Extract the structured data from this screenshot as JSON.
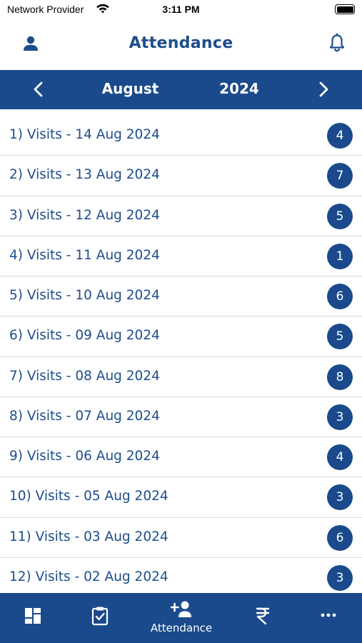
{
  "status_bar": {
    "carrier": "Network Provider",
    "time": "3:11 PM"
  },
  "header": {
    "title": "Attendance",
    "left_icon": "profile-icon",
    "right_icon": "bell-icon"
  },
  "month_selector": {
    "month": "August",
    "year": "2024",
    "prev_icon": "chevron-left-icon",
    "next_icon": "chevron-right-icon"
  },
  "visits": [
    {
      "label": "1) Visits - 14 Aug 2024",
      "count": "4"
    },
    {
      "label": "2) Visits - 13 Aug 2024",
      "count": "7"
    },
    {
      "label": "3) Visits - 12 Aug 2024",
      "count": "5"
    },
    {
      "label": "4) Visits - 11 Aug 2024",
      "count": "1"
    },
    {
      "label": "5) Visits - 10 Aug 2024",
      "count": "6"
    },
    {
      "label": "6) Visits - 09 Aug 2024",
      "count": "5"
    },
    {
      "label": "7) Visits - 08 Aug 2024",
      "count": "8"
    },
    {
      "label": "8) Visits - 07 Aug 2024",
      "count": "3"
    },
    {
      "label": "9) Visits - 06 Aug 2024",
      "count": "4"
    },
    {
      "label": "10) Visits - 05 Aug 2024",
      "count": "3"
    },
    {
      "label": "11) Visits - 03 Aug 2024",
      "count": "6"
    },
    {
      "label": "12) Visits - 02 Aug 2024",
      "count": "3"
    }
  ],
  "tab_bar": {
    "tabs": [
      {
        "icon": "dashboard-icon",
        "label": ""
      },
      {
        "icon": "clipboard-check-icon",
        "label": ""
      },
      {
        "icon": "person-add-icon",
        "label": "Attendance"
      },
      {
        "icon": "rupee-icon",
        "label": ""
      },
      {
        "icon": "more-icon",
        "label": ""
      }
    ]
  },
  "colors": {
    "primary": "#1a4a8c",
    "text": "#1d4d8c",
    "divider": "#d9d9d9",
    "background": "#ffffff"
  }
}
